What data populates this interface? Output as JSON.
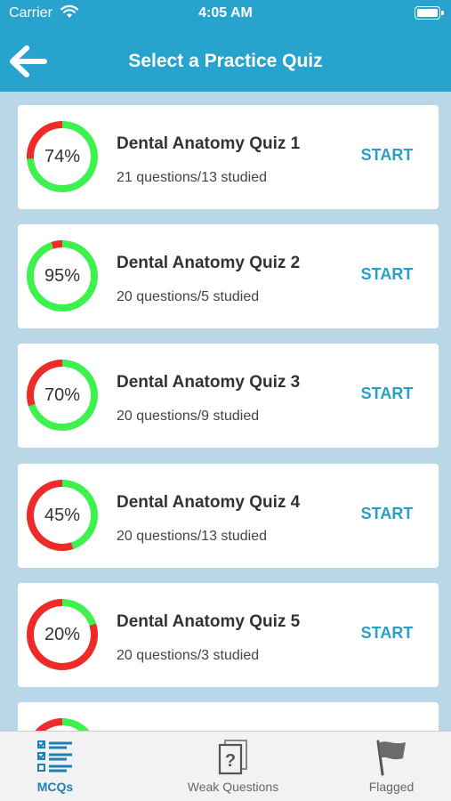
{
  "status_bar": {
    "carrier": "Carrier",
    "time": "4:05 AM"
  },
  "nav": {
    "title": "Select a Practice Quiz",
    "back_icon": "arrow-left-icon"
  },
  "colors": {
    "accent": "#27a3cd",
    "start": "#2a9fc6",
    "ring_done": "#3df24f",
    "ring_todo": "#f02a2a",
    "tab_active": "#1f7fb4"
  },
  "quizzes": [
    {
      "title": "Dental Anatomy Quiz 1",
      "subtitle": "21 questions/13 studied",
      "percent_label": "74%",
      "percent": 74,
      "start_label": "START"
    },
    {
      "title": "Dental Anatomy Quiz 2",
      "subtitle": "20 questions/5 studied",
      "percent_label": "95%",
      "percent": 95,
      "start_label": "START"
    },
    {
      "title": "Dental Anatomy Quiz 3",
      "subtitle": "20 questions/9 studied",
      "percent_label": "70%",
      "percent": 70,
      "start_label": "START"
    },
    {
      "title": "Dental Anatomy Quiz 4",
      "subtitle": "20 questions/13 studied",
      "percent_label": "45%",
      "percent": 45,
      "start_label": "START"
    },
    {
      "title": "Dental Anatomy Quiz 5",
      "subtitle": "20 questions/3 studied",
      "percent_label": "20%",
      "percent": 20,
      "start_label": "START"
    }
  ],
  "tabs": [
    {
      "label": "MCQs",
      "icon": "checklist-icon",
      "active": true
    },
    {
      "label": "Weak Questions",
      "icon": "question-card-icon",
      "active": false
    },
    {
      "label": "Flagged",
      "icon": "flag-icon",
      "active": false
    }
  ]
}
